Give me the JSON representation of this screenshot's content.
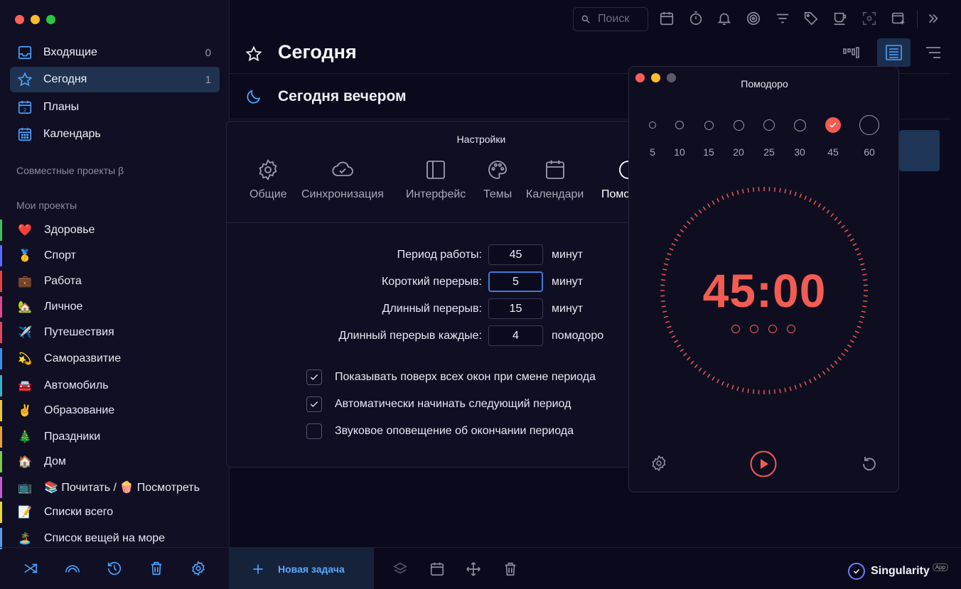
{
  "sidebar": {
    "nav": [
      {
        "label": "Входящие",
        "count": "0",
        "icon": "inbox-icon"
      },
      {
        "label": "Сегодня",
        "count": "1",
        "icon": "star-icon"
      },
      {
        "label": "Планы",
        "count": "",
        "icon": "calendar-day-icon"
      },
      {
        "label": "Календарь",
        "count": "",
        "icon": "calendar-grid-icon"
      }
    ],
    "shared_label": "Совместные проекты β",
    "my_projects_label": "Мои проекты",
    "projects": [
      {
        "emoji": "❤️",
        "label": "Здоровье",
        "color": "#3fbf5a"
      },
      {
        "emoji": "🥇",
        "label": "Спорт",
        "color": "#5a6bff"
      },
      {
        "emoji": "💼",
        "label": "Работа",
        "color": "#e0463f"
      },
      {
        "emoji": "🏡",
        "label": "Личное",
        "color": "#d94a8c"
      },
      {
        "emoji": "✈️",
        "label": "Путешествия",
        "color": "#d94a5c"
      },
      {
        "emoji": "💫",
        "label": "Саморазвитие",
        "color": "#3a8fe8"
      },
      {
        "emoji": "🚘",
        "label": "Автомобиль",
        "color": "#3ab0c8"
      },
      {
        "emoji": "✌️",
        "label": "Образование",
        "color": "#e8c83a"
      },
      {
        "emoji": "🎄",
        "label": "Праздники",
        "color": "#e8a03a"
      },
      {
        "emoji": "🏠",
        "label": "Дом",
        "color": "#7cc850"
      },
      {
        "emoji": "📺",
        "label": "📚 Почитать / 🍿 Посмотреть",
        "color": "#c85ad0"
      },
      {
        "emoji": "📝",
        "label": "Списки всего",
        "color": "#e8d83a"
      },
      {
        "emoji": "🏝️",
        "label": "Список вещей на море",
        "color": "#5a9be8"
      }
    ]
  },
  "toolbar": {
    "search_placeholder": "Поиск"
  },
  "main": {
    "title": "Сегодня",
    "evening_title": "Сегодня вечером",
    "new_task_label": "Новая задача",
    "brand_name": "Singularity",
    "brand_tag": "App"
  },
  "settings": {
    "title": "Настройки",
    "tabs": [
      "Общие",
      "Синхронизация",
      "Интерфейс",
      "Темы",
      "Календари",
      "Помодоро"
    ],
    "fields": [
      {
        "label": "Период работы:",
        "value": "45",
        "unit": "минут"
      },
      {
        "label": "Короткий перерыв:",
        "value": "5",
        "unit": "минут"
      },
      {
        "label": "Длинный перерыв:",
        "value": "15",
        "unit": "минут"
      },
      {
        "label": "Длинный перерыв каждые:",
        "value": "4",
        "unit": "помодоро"
      }
    ],
    "checkboxes": [
      {
        "label": "Показывать поверх всех окон при смене периода",
        "checked": true
      },
      {
        "label": "Автоматически начинать следующий период",
        "checked": true
      },
      {
        "label": "Звуковое оповещение об окончании периода",
        "checked": false
      }
    ]
  },
  "pomodoro": {
    "title": "Помодоро",
    "durations": [
      "5",
      "10",
      "15",
      "20",
      "25",
      "30",
      "45",
      "60"
    ],
    "selected_index": 6,
    "time": "45:00",
    "completed_rounds": 0,
    "total_rounds": 4
  },
  "colors": {
    "accent": "#f25c52",
    "blue": "#4aa3ff"
  }
}
